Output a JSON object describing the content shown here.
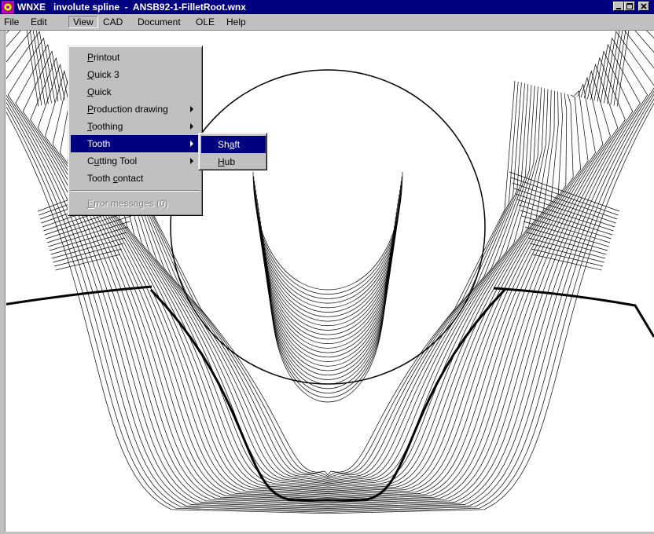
{
  "window": {
    "title": "WNXE   involute spline  -  ANSB92-1-FilletRoot.wnx",
    "controls": [
      "minimize",
      "maximize",
      "close"
    ]
  },
  "menubar": {
    "items": [
      {
        "label": "File"
      },
      {
        "label": "Edit"
      },
      {
        "label": "View",
        "active": true
      },
      {
        "label": "CAD"
      },
      {
        "label": "Document"
      },
      {
        "label": "OLE"
      },
      {
        "label": "Help"
      }
    ]
  },
  "view_menu": {
    "items": [
      {
        "pre": "",
        "ul": "P",
        "post": "rintout"
      },
      {
        "pre": "",
        "ul": "Q",
        "post": "uick 3"
      },
      {
        "pre": "",
        "ul": "Q",
        "post": "uick"
      },
      {
        "pre": "",
        "ul": "P",
        "post": "roduction drawing",
        "submenu": true
      },
      {
        "pre": "",
        "ul": "T",
        "post": "oothing",
        "submenu": true
      },
      {
        "pre": "Tooth",
        "ul": "",
        "post": "",
        "submenu": true,
        "selected": true
      },
      {
        "pre": "C",
        "ul": "u",
        "post": "tting Tool",
        "submenu": true
      },
      {
        "pre": "Tooth ",
        "ul": "c",
        "post": "ontact"
      }
    ],
    "disabled_item": {
      "pre": "",
      "ul": "E",
      "post": "rror messages (0)"
    }
  },
  "tooth_submenu": {
    "items": [
      {
        "pre": "Sh",
        "ul": "a",
        "post": "ft",
        "selected": true
      },
      {
        "pre": "",
        "ul": "H",
        "post": "ub"
      }
    ]
  },
  "colors": {
    "titlebar": "#000080",
    "face": "#c0c0c0",
    "highlight": "#000080",
    "drawing": "#000000",
    "canvas": "#ffffff"
  },
  "icons": {
    "app": "gear-icon",
    "minimize": "minimize-icon",
    "maximize": "maximize-icon",
    "close": "close-icon",
    "submenu": "chevron-right-icon"
  }
}
